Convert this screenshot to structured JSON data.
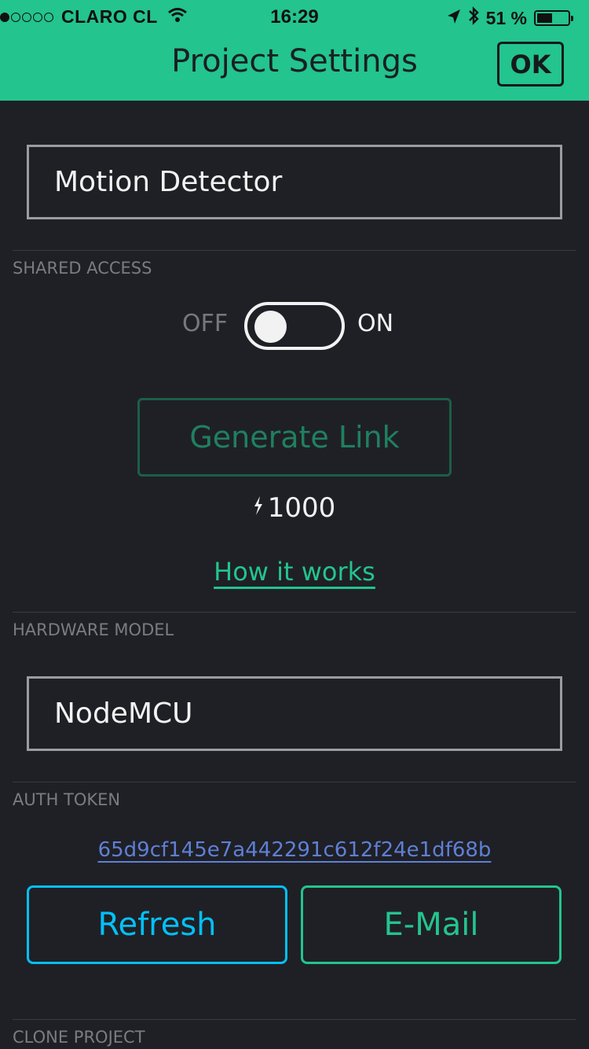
{
  "status_bar": {
    "carrier": "CLARO CL",
    "time": "16:29",
    "battery": "51 %",
    "battery_level": 0.51,
    "icons": [
      "signal-dots-icon",
      "wifi-icon",
      "location-arrow-icon",
      "bluetooth-icon",
      "battery-icon"
    ]
  },
  "header": {
    "title": "Project Settings",
    "ok_label": "OK",
    "background_color": "#23c48e"
  },
  "project": {
    "name": "Motion Detector"
  },
  "shared_access": {
    "label": "SHARED ACCESS",
    "off_label": "OFF",
    "on_label": "ON",
    "toggle_state": "off",
    "generate_label": "Generate Link",
    "energy_icon": "lightning-bolt-icon",
    "energy_value": "1000",
    "how_it_works": "How it works"
  },
  "hardware": {
    "label": "HARDWARE MODEL",
    "model": "NodeMCU"
  },
  "auth": {
    "label": "AUTH TOKEN",
    "token": "65d9cf145e7a442291c612f24e1df68b",
    "refresh_label": "Refresh",
    "email_label": "E-Mail",
    "token_color": "#5f7fd6",
    "refresh_color": "#04c0f8",
    "email_color": "#23c48e"
  },
  "clone": {
    "label": "CLONE PROJECT"
  }
}
